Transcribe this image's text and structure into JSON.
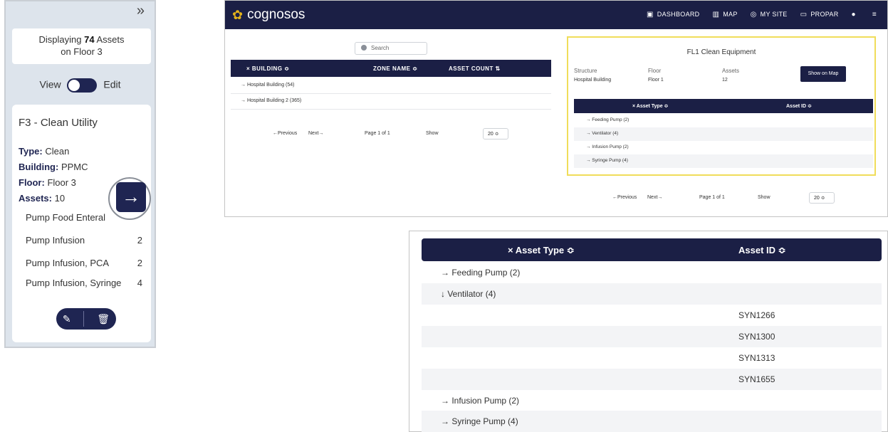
{
  "left_panel": {
    "collapse_icon": "»",
    "displaying_prefix": "Displaying",
    "displaying_count": "74",
    "displaying_suffix": "Assets",
    "displaying_line2": "on Floor 3",
    "view_label": "View",
    "edit_label": "Edit",
    "zone_title": "F3 - Clean Utility",
    "type_label": "Type:",
    "type_value": "Clean",
    "building_label": "Building:",
    "building_value": "PPMC",
    "floor_label": "Floor:",
    "floor_value": "Floor 3",
    "assets_label": "Assets:",
    "assets_value": "10",
    "asset_lines": [
      {
        "name": "Pump Food Enteral",
        "count": ""
      },
      {
        "name": "Pump Infusion",
        "count": "2"
      },
      {
        "name": "Pump Infusion, PCA",
        "count": "2"
      },
      {
        "name": "Pump Infusion, Syringe",
        "count": "4"
      }
    ],
    "arrow_icon": "→",
    "edit_icon": "✎",
    "delete_icon": "🗑"
  },
  "app": {
    "brand": "cognosos",
    "nav": [
      {
        "icon": "▣",
        "label": "DASHBOARD"
      },
      {
        "icon": "▥",
        "label": "MAP"
      },
      {
        "icon": "◎",
        "label": "MY SITE"
      },
      {
        "icon": "▭",
        "label": "PROPAR"
      },
      {
        "icon": "●",
        "label": ""
      },
      {
        "icon": "≡",
        "label": ""
      }
    ],
    "search_placeholder": "Search",
    "building_table": {
      "col_building": "× BUILDING ≎",
      "col_zone": "ZONE NAME ≎",
      "col_count": "ASSET COUNT ⇅",
      "rows": [
        "→ Hospital Building (54)",
        "→ Hospital Building 2 (365)"
      ]
    },
    "pagination": {
      "prev": "←Previous",
      "next": "Next→",
      "page": "Page 1 of 1",
      "show": "Show",
      "size": "20 ≎"
    },
    "detail": {
      "title": "FL1 Clean Equipment",
      "structure_label": "Structure",
      "structure_value": "Hospital Building",
      "floor_label": "Floor",
      "floor_value": "Floor 1",
      "assets_label": "Assets",
      "assets_value": "12",
      "show_on_map": "Show on Map",
      "col_type": "× Asset Type ≎",
      "col_id": "Asset ID ≎",
      "rows": [
        "→ Feeding Pump (2)",
        "→ Ventilator (4)",
        "→ Infusion Pump (2)",
        "→ Syringe Pump (4)"
      ]
    }
  },
  "zoom": {
    "col_type": "× Asset Type ≎",
    "col_id": "Asset ID ≎",
    "rows": [
      {
        "text": "→ Feeding Pump (2)",
        "id": ""
      },
      {
        "text": "↓ Ventilator (4)",
        "id": ""
      },
      {
        "text": "",
        "id": "SYN1266"
      },
      {
        "text": "",
        "id": "SYN1300"
      },
      {
        "text": "",
        "id": "SYN1313"
      },
      {
        "text": "",
        "id": "SYN1655"
      },
      {
        "text": "→ Infusion Pump (2)",
        "id": ""
      },
      {
        "text": "→ Syringe Pump (4)",
        "id": ""
      }
    ]
  }
}
